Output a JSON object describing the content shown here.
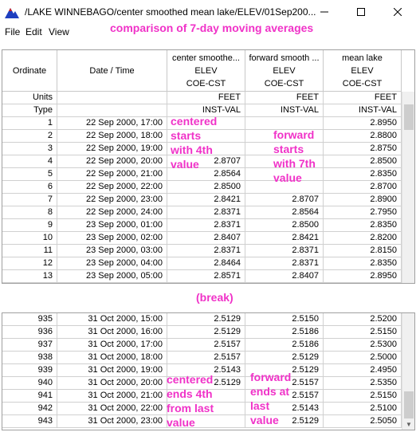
{
  "window": {
    "title": "/LAKE WINNEBAGO/center smoothed mean lake/ELEV/01Sep200...",
    "app_icon": "hec-dss-mountain-icon",
    "controls": [
      "minimize-icon",
      "maximize-icon",
      "close-icon"
    ]
  },
  "menu": {
    "items": [
      "File",
      "Edit",
      "View"
    ]
  },
  "annotations": {
    "title": "comparison of 7-day moving averages",
    "break": "(break)",
    "centered_start": "centered\nstarts\nwith 4th\nvalue",
    "forward_start": "forward\nstarts\nwith 7th\nvalue",
    "centered_end": "centered\nends 4th\nfrom last\nvalue",
    "forward_end": "forward\nends at\nlast\nvalue"
  },
  "table": {
    "columns": [
      {
        "header": [
          "Ordinate"
        ]
      },
      {
        "header": [
          "Date / Time"
        ]
      },
      {
        "header": [
          "center smoothe...",
          "ELEV",
          "COE-CST"
        ]
      },
      {
        "header": [
          "forward smooth ...",
          "ELEV",
          "COE-CST"
        ]
      },
      {
        "header": [
          "mean lake",
          "ELEV",
          "COE-CST"
        ]
      }
    ],
    "meta_rows": [
      {
        "label": "Units",
        "values": [
          "FEET",
          "FEET",
          "FEET"
        ]
      },
      {
        "label": "Type",
        "values": [
          "INST-VAL",
          "INST-VAL",
          "INST-VAL"
        ]
      }
    ],
    "top_rows": [
      [
        "1",
        "22 Sep 2000, 17:00",
        "",
        "",
        "2.8950"
      ],
      [
        "2",
        "22 Sep 2000, 18:00",
        "",
        "",
        "2.8800"
      ],
      [
        "3",
        "22 Sep 2000, 19:00",
        "",
        "",
        "2.8750"
      ],
      [
        "4",
        "22 Sep 2000, 20:00",
        "2.8707",
        "",
        "2.8500"
      ],
      [
        "5",
        "22 Sep 2000, 21:00",
        "2.8564",
        "",
        "2.8350"
      ],
      [
        "6",
        "22 Sep 2000, 22:00",
        "2.8500",
        "",
        "2.8700"
      ],
      [
        "7",
        "22 Sep 2000, 23:00",
        "2.8421",
        "2.8707",
        "2.8900"
      ],
      [
        "8",
        "22 Sep 2000, 24:00",
        "2.8371",
        "2.8564",
        "2.7950"
      ],
      [
        "9",
        "23 Sep 2000, 01:00",
        "2.8371",
        "2.8500",
        "2.8350"
      ],
      [
        "10",
        "23 Sep 2000, 02:00",
        "2.8407",
        "2.8421",
        "2.8200"
      ],
      [
        "11",
        "23 Sep 2000, 03:00",
        "2.8371",
        "2.8371",
        "2.8150"
      ],
      [
        "12",
        "23 Sep 2000, 04:00",
        "2.8464",
        "2.8371",
        "2.8350"
      ],
      [
        "13",
        "23 Sep 2000, 05:00",
        "2.8571",
        "2.8407",
        "2.8950"
      ]
    ],
    "bottom_rows": [
      [
        "935",
        "31 Oct 2000, 15:00",
        "2.5129",
        "2.5150",
        "2.5200"
      ],
      [
        "936",
        "31 Oct 2000, 16:00",
        "2.5129",
        "2.5186",
        "2.5150"
      ],
      [
        "937",
        "31 Oct 2000, 17:00",
        "2.5157",
        "2.5186",
        "2.5300"
      ],
      [
        "938",
        "31 Oct 2000, 18:00",
        "2.5157",
        "2.5129",
        "2.5000"
      ],
      [
        "939",
        "31 Oct 2000, 19:00",
        "2.5143",
        "2.5129",
        "2.4950"
      ],
      [
        "940",
        "31 Oct 2000, 20:00",
        "2.5129",
        "2.5157",
        "2.5350"
      ],
      [
        "941",
        "31 Oct 2000, 21:00",
        "",
        "2.5157",
        "2.5150"
      ],
      [
        "942",
        "31 Oct 2000, 22:00",
        "",
        "2.5143",
        "2.5100"
      ],
      [
        "943",
        "31 Oct 2000, 23:00",
        "",
        "2.5129",
        "2.5050"
      ]
    ]
  },
  "colors": {
    "annotation": "#f032c8",
    "grid": "#d0d0d0",
    "scroll_thumb": "#cdcdcd"
  }
}
